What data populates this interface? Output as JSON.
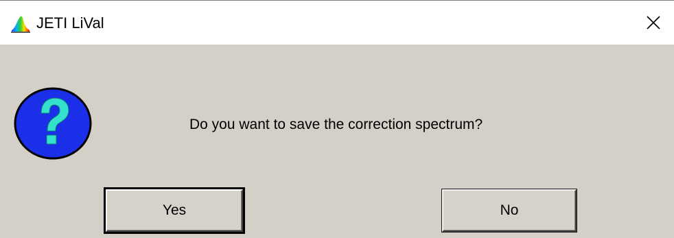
{
  "window": {
    "title": "JETI LiVal",
    "app_icon": "spectrum-app-icon",
    "close_icon": "close-icon"
  },
  "dialog": {
    "icon": "question-icon",
    "message": "Do you want to save the correction spectrum?",
    "buttons": {
      "yes_label": "Yes",
      "no_label": "No"
    }
  },
  "colors": {
    "dialog_background": "#d4d0c8",
    "titlebar_background": "#ffffff",
    "question_circle": "#1c2fe8",
    "question_mark": "#35e0cc"
  }
}
